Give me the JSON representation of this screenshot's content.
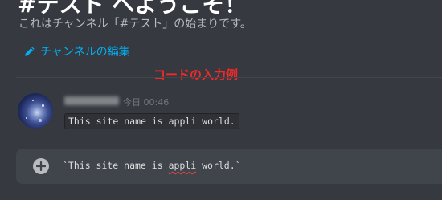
{
  "channel": {
    "title_partial": "#テスト へようこそ！",
    "welcome_text": "これはチャンネル「#テスト」の始まりです。",
    "edit_link_label": "チャンネルの編集",
    "edit_icon": "pencil-icon"
  },
  "annotation": {
    "label": "コードの入力例",
    "color": "#f02a2a"
  },
  "message": {
    "timestamp": "今日 00:46",
    "content": "This site name is appli world."
  },
  "composer": {
    "add_icon": "plus-circle-icon",
    "text_before": "`This site name is ",
    "text_misspelled": "appli",
    "text_after": " world.`"
  },
  "colors": {
    "background": "#36393f",
    "link": "#00aff4",
    "composer_bg": "#40444b",
    "code_bg": "#2f3136"
  }
}
